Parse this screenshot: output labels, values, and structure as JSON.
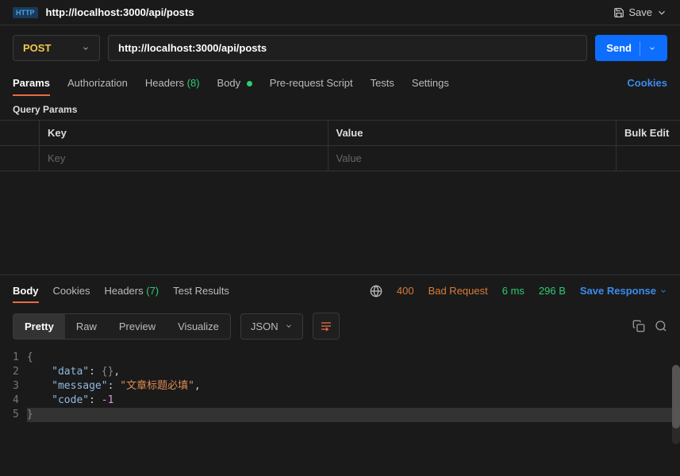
{
  "topbar": {
    "badge": "HTTP",
    "title": "http://localhost:3000/api/posts",
    "save_label": "Save"
  },
  "request": {
    "method": "POST",
    "url": "http://localhost:3000/api/posts",
    "send_label": "Send"
  },
  "tabs": {
    "params": "Params",
    "authorization": "Authorization",
    "headers": "Headers",
    "headers_count": "(8)",
    "body": "Body",
    "prerequest": "Pre-request Script",
    "tests": "Tests",
    "settings": "Settings",
    "cookies": "Cookies"
  },
  "params": {
    "section_title": "Query Params",
    "key_header": "Key",
    "value_header": "Value",
    "bulk_edit": "Bulk Edit",
    "key_placeholder": "Key",
    "value_placeholder": "Value"
  },
  "response_tabs": {
    "body": "Body",
    "cookies": "Cookies",
    "headers": "Headers",
    "headers_count": "(7)",
    "test_results": "Test Results"
  },
  "status": {
    "code": "400",
    "text": "Bad Request",
    "time": "6 ms",
    "size": "296 B",
    "save_response": "Save Response"
  },
  "view": {
    "pretty": "Pretty",
    "raw": "Raw",
    "preview": "Preview",
    "visualize": "Visualize",
    "format": "JSON"
  },
  "code": {
    "lines": [
      "1",
      "2",
      "3",
      "4",
      "5"
    ],
    "l1_brace": "{",
    "l2_key": "\"data\"",
    "l2_val": "{}",
    "l3_key": "\"message\"",
    "l3_val": "\"文章标题必填\"",
    "l4_key": "\"code\"",
    "l4_val": "-1",
    "l5_brace": "}"
  }
}
